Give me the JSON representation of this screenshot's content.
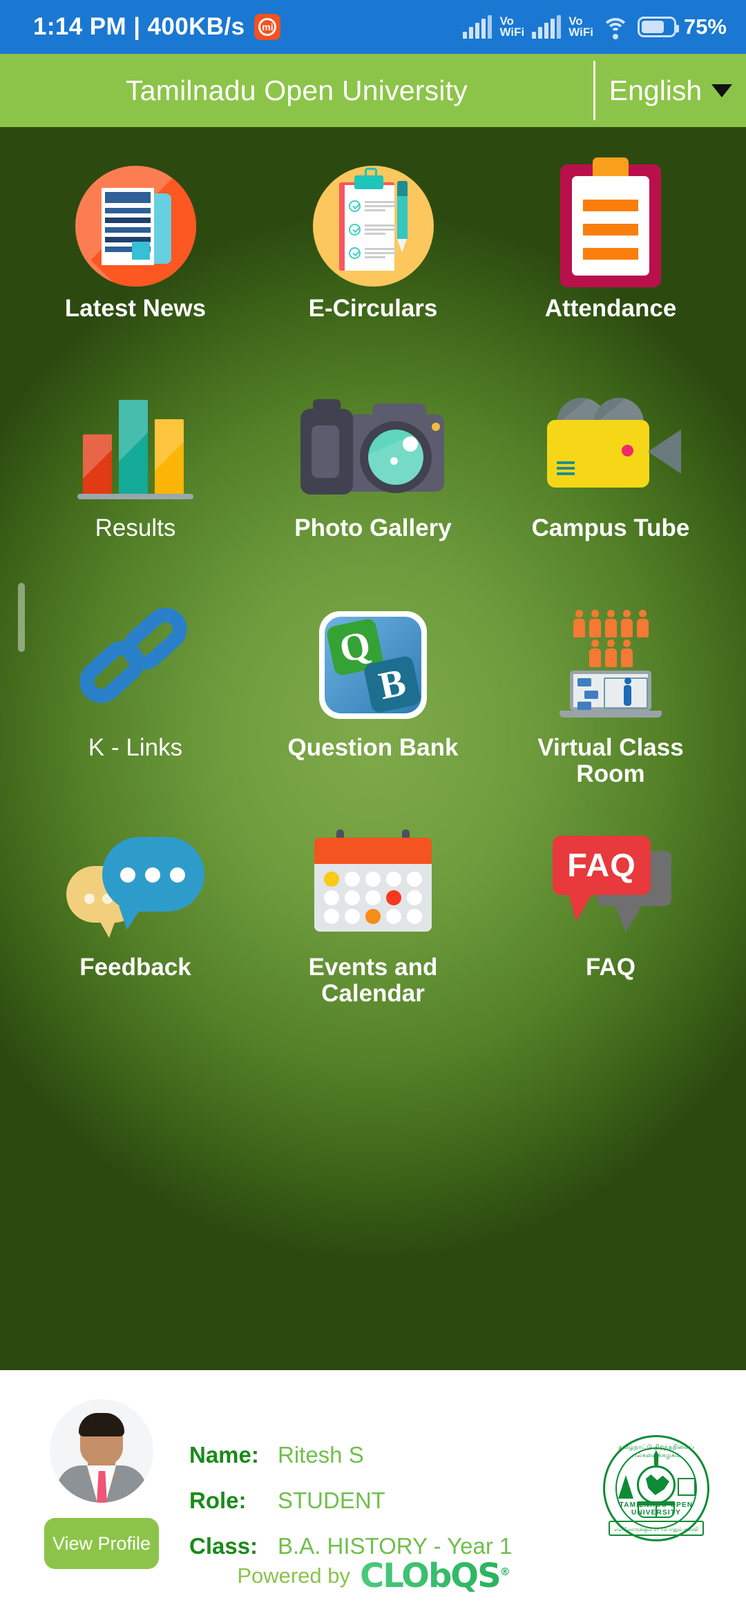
{
  "status_bar": {
    "time": "1:14 PM",
    "separator": "|",
    "network_speed": "400KB/s",
    "mi_badge": "mi",
    "vowifi_1_top": "Vo",
    "vowifi_1_bottom": "WiFi",
    "vowifi_2_top": "Vo",
    "vowifi_2_bottom": "WiFi",
    "battery_percent": "75%",
    "bg_color": "#1a78d2"
  },
  "header": {
    "title": "Tamilnadu Open University",
    "language": "English",
    "bg_color": "#8cc449"
  },
  "grid": {
    "items": [
      {
        "label": "Latest News",
        "icon": "newspaper-icon"
      },
      {
        "label": "E-Circulars",
        "icon": "clipboard-checklist-icon"
      },
      {
        "label": "Attendance",
        "icon": "attendance-clipboard-icon"
      },
      {
        "label": "Results",
        "icon": "bar-chart-icon"
      },
      {
        "label": "Photo Gallery",
        "icon": "camera-icon"
      },
      {
        "label": "Campus Tube",
        "icon": "video-camera-icon"
      },
      {
        "label": "K - Links",
        "icon": "chain-link-icon"
      },
      {
        "label": "Question Bank",
        "icon": "question-bank-icon"
      },
      {
        "label": "Virtual Class Room",
        "icon": "virtual-classroom-icon"
      },
      {
        "label": "Feedback",
        "icon": "speech-bubbles-icon"
      },
      {
        "label": "Events and Calendar",
        "icon": "calendar-icon"
      },
      {
        "label": "FAQ",
        "icon": "faq-bubble-icon"
      }
    ],
    "faq_badge_text": "FAQ",
    "qb_letter_q": "Q",
    "qb_letter_b": "B"
  },
  "footer": {
    "view_profile_label": "View Profile",
    "name_key": "Name:",
    "name_value": "Ritesh S",
    "role_key": "Role:",
    "role_value": "STUDENT",
    "class_key": "Class:",
    "class_value": "B.A. HISTORY - Year 1",
    "seal_top_text": "தமிழ்நாட்டு திறந்தநிலைப் பல்கலைக்கழகம்",
    "seal_bottom_text": "TAMILNADU OPEN UNIVERSITY",
    "seal_motto": "எல்லோருக்கும் எப்போதும் கல்வி",
    "powered_by_label": "Powered by",
    "powered_by_brand": "CLObQS",
    "registered_mark": "®",
    "accent_green": "#8cc449",
    "key_green": "#1a8a1a",
    "value_green": "#6fbf4a"
  }
}
